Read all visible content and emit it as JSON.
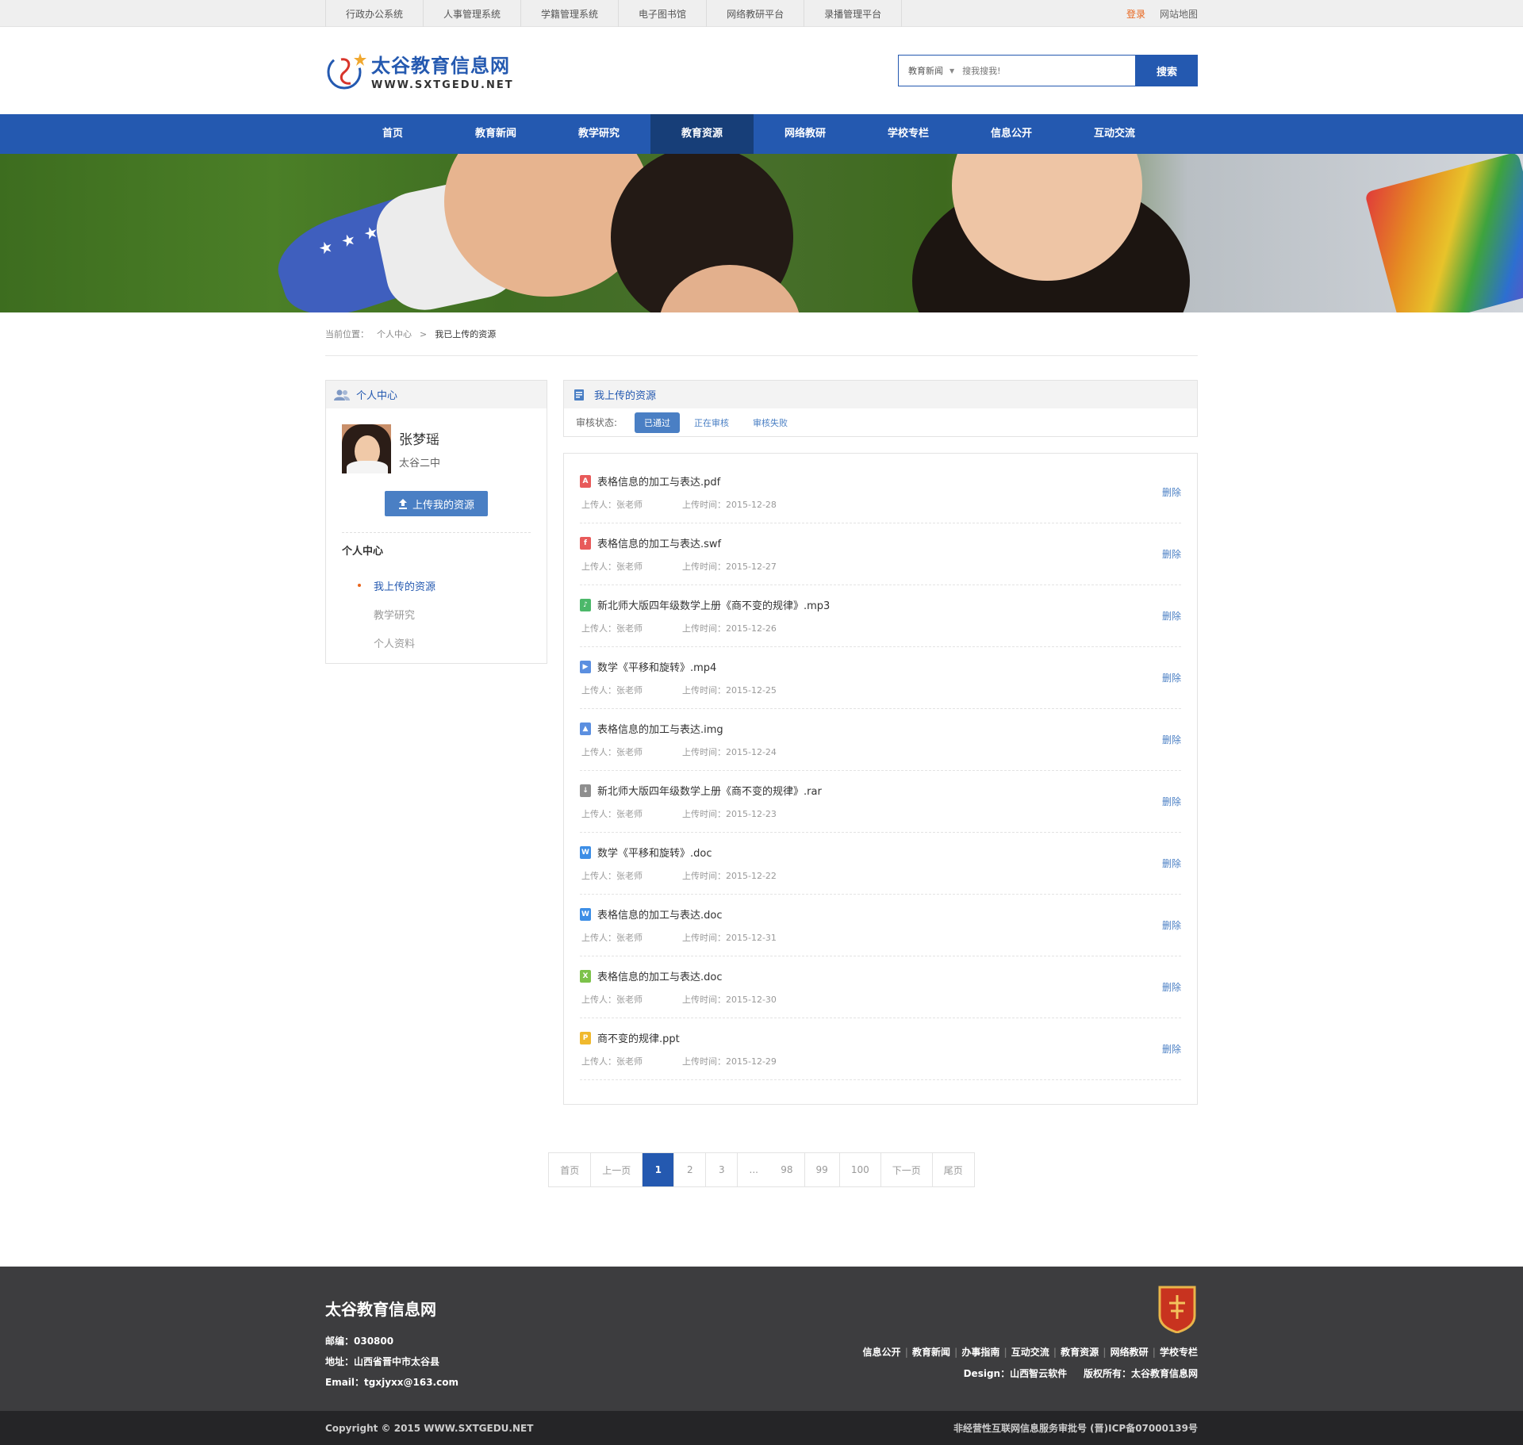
{
  "topbar": {
    "links": [
      "行政办公系统",
      "人事管理系统",
      "学籍管理系统",
      "电子图书馆",
      "网络教研平台",
      "录播管理平台"
    ],
    "login": "登录",
    "sitemap": "网站地图"
  },
  "header": {
    "logo_cn": "太谷教育信息网",
    "logo_en": "WWW.SXTGEDU.NET",
    "search_category": "教育新闻",
    "search_placeholder": "搜我搜我!",
    "search_button": "搜索"
  },
  "nav": {
    "items": [
      "首页",
      "教育新闻",
      "教学研究",
      "教育资源",
      "网络教研",
      "学校专栏",
      "信息公开",
      "互动交流"
    ],
    "active_index": 3
  },
  "breadcrumb": {
    "label": "当前位置：",
    "items": [
      "个人中心",
      "我已上传的资源"
    ],
    "sep": ">"
  },
  "sidebar": {
    "title": "个人中心",
    "user_name": "张梦瑶",
    "user_school": "太谷二中",
    "upload_button": "上传我的资源",
    "section_title": "个人中心",
    "menu": [
      "我上传的资源",
      "教学研究",
      "个人资料"
    ],
    "menu_active": 0
  },
  "resources": {
    "title": "我上传的资源",
    "filter_label": "审核状态:",
    "filters": [
      "已通过",
      "正在审核",
      "审核失败"
    ],
    "filter_active": 0,
    "delete_label": "删除",
    "items": [
      {
        "name": "表格信息的加工与表达.pdf",
        "uploader": "上传人：张老师",
        "time": "上传时间：2015-12-28",
        "icon": "pdf-icon",
        "color": "#e85a5a"
      },
      {
        "name": "表格信息的加工与表达.swf",
        "uploader": "上传人：张老师",
        "time": "上传时间：2015-12-27",
        "icon": "swf-icon",
        "color": "#e85a5a"
      },
      {
        "name": "新北师大版四年级数学上册《商不变的规律》.mp3",
        "uploader": "上传人：张老师",
        "time": "上传时间：2015-12-26",
        "icon": "audio-icon",
        "color": "#4cb86a"
      },
      {
        "name": "数学《平移和旋转》.mp4",
        "uploader": "上传人：张老师",
        "time": "上传时间：2015-12-25",
        "icon": "video-icon",
        "color": "#5b8fe0"
      },
      {
        "name": "表格信息的加工与表达.img",
        "uploader": "上传人：张老师",
        "time": "上传时间：2015-12-24",
        "icon": "image-icon",
        "color": "#5b8fe0"
      },
      {
        "name": "新北师大版四年级数学上册《商不变的规律》.rar",
        "uploader": "上传人：张老师",
        "time": "上传时间：2015-12-23",
        "icon": "archive-icon",
        "color": "#8e8e8e"
      },
      {
        "name": "数学《平移和旋转》.doc",
        "uploader": "上传人：张老师",
        "time": "上传时间：2015-12-22",
        "icon": "word-icon",
        "color": "#3d8ee6"
      },
      {
        "name": "表格信息的加工与表达.doc",
        "uploader": "上传人：张老师",
        "time": "上传时间：2015-12-31",
        "icon": "word-icon",
        "color": "#3d8ee6"
      },
      {
        "name": "表格信息的加工与表达.doc",
        "uploader": "上传人：张老师",
        "time": "上传时间：2015-12-30",
        "icon": "excel-icon",
        "color": "#7cc24a"
      },
      {
        "name": "商不变的规律.ppt",
        "uploader": "上传人：张老师",
        "time": "上传时间：2015-12-29",
        "icon": "ppt-icon",
        "color": "#f0b92e"
      }
    ]
  },
  "pager": {
    "items": [
      "首页",
      "上一页",
      "1",
      "2",
      "3",
      "...",
      "98",
      "99",
      "100",
      "下一页",
      "尾页"
    ],
    "current": "1"
  },
  "footer": {
    "title": "太谷教育信息网",
    "zip": "邮编：030800",
    "address": "地址：山西省晋中市太谷县",
    "email": "Email：tgxjyxx@163.com",
    "links": [
      "信息公开",
      "教育新闻",
      "办事指南",
      "互动交流",
      "教育资源",
      "网络教研",
      "学校专栏"
    ],
    "design": "Design：山西智云软件",
    "rights": "版权所有：太谷教育信息网",
    "copyright": "Copyright © 2015 WWW.SXTGEDU.NET",
    "icp": "非经营性互联网信息服务审批号 (晋)ICP备07000139号"
  },
  "colors": {
    "brand": "#2459b0",
    "nav_active": "#173e78",
    "accent": "#e8641b",
    "link": "#4a7fc4"
  }
}
